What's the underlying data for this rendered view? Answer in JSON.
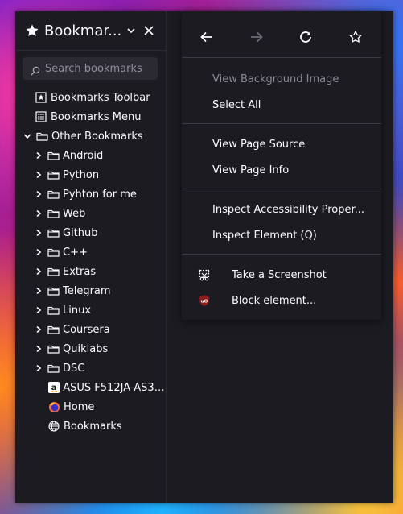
{
  "sidebar": {
    "title": "Bookmar...",
    "search": {
      "placeholder": "Search bookmarks"
    },
    "items": [
      {
        "label": "Bookmarks Toolbar",
        "icon": "bookmarks-toolbar-icon",
        "level": 1
      },
      {
        "label": "Bookmarks Menu",
        "icon": "bookmarks-menu-icon",
        "level": 1
      },
      {
        "label": "Other Bookmarks",
        "icon": "folder-icon",
        "level": 0,
        "expanded": true
      },
      {
        "label": "Android",
        "icon": "folder-icon",
        "level": 1
      },
      {
        "label": "Python",
        "icon": "folder-icon",
        "level": 1
      },
      {
        "label": "Pyhton for me",
        "icon": "folder-icon",
        "level": 1
      },
      {
        "label": "Web",
        "icon": "folder-icon",
        "level": 1
      },
      {
        "label": "Github",
        "icon": "folder-icon",
        "level": 1
      },
      {
        "label": "C++",
        "icon": "folder-icon",
        "level": 1
      },
      {
        "label": "Extras",
        "icon": "folder-icon",
        "level": 1
      },
      {
        "label": "Telegram",
        "icon": "folder-icon",
        "level": 1
      },
      {
        "label": "Linux",
        "icon": "folder-icon",
        "level": 1
      },
      {
        "label": "Coursera",
        "icon": "folder-icon",
        "level": 1
      },
      {
        "label": "Quiklabs",
        "icon": "folder-icon",
        "level": 1
      },
      {
        "label": "DSC",
        "icon": "folder-icon",
        "level": 1
      },
      {
        "label": "ASUS F512JA-AS34...",
        "icon": "amazon-icon",
        "level": 2
      },
      {
        "label": "Home",
        "icon": "firefox-icon",
        "level": 2
      },
      {
        "label": "Bookmarks",
        "icon": "globe-icon",
        "level": 2
      }
    ]
  },
  "context_menu": {
    "view_background_image": "View Background Image",
    "select_all": "Select All",
    "view_page_source": "View Page Source",
    "view_page_info": "View Page Info",
    "inspect_accessibility": "Inspect Accessibility Proper...",
    "inspect_element": "Inspect Element (Q)",
    "take_screenshot": "Take a Screenshot",
    "block_element": "Block element..."
  },
  "colors": {
    "panel_bg": "#1c1b22",
    "text": "#fbfbfe",
    "disabled_text": "#8a8a95",
    "ublock_red": "#8e1b1b"
  }
}
